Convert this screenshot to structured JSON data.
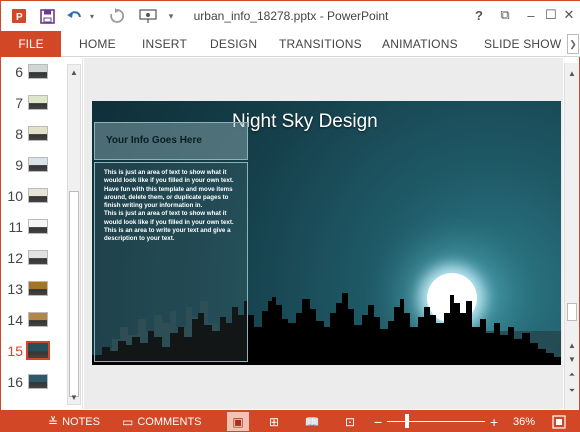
{
  "window": {
    "title": "urban_info_18278.pptx - PowerPoint",
    "controls": [
      "?",
      "⧉",
      "–",
      "☐",
      "✕"
    ]
  },
  "quick_access": {
    "icons": [
      "powerpoint-logo-icon",
      "save-icon",
      "undo-icon",
      "undo-dropdown-icon",
      "redo-icon",
      "present-icon",
      "customize-icon"
    ]
  },
  "ribbon": {
    "file_label": "FILE",
    "tabs": [
      "HOME",
      "INSERT",
      "DESIGN",
      "TRANSITIONS",
      "ANIMATIONS",
      "SLIDE SHOW"
    ]
  },
  "thumbnails": {
    "slides": [
      {
        "num": "6",
        "active": false
      },
      {
        "num": "7",
        "active": false
      },
      {
        "num": "8",
        "active": false
      },
      {
        "num": "9",
        "active": false
      },
      {
        "num": "10",
        "active": false
      },
      {
        "num": "11",
        "active": false
      },
      {
        "num": "12",
        "active": false
      },
      {
        "num": "13",
        "active": false
      },
      {
        "num": "14",
        "active": false
      },
      {
        "num": "15",
        "active": true
      },
      {
        "num": "16",
        "active": false
      }
    ]
  },
  "slide": {
    "title": "Night Sky Design",
    "info_header": "Your Info Goes Here",
    "info_body": "This is just an area of text to show what it would look like if you filled in your own text. Have fun with this template and move items around, delete them, or duplicate pages to finish writing your information in.\nThis is just an area of text to show what it would look like if you filled in your own text.\nThis is an area to write your text and give a description to your text.",
    "colors": {
      "sky": "#153f4a",
      "moon": "#ffffff",
      "skyline": "#000000"
    }
  },
  "statusbar": {
    "notes_label": "NOTES",
    "comments_label": "COMMENTS",
    "zoom_level": "36%",
    "zoom_fraction": 0.36,
    "accent": "#d24726"
  }
}
